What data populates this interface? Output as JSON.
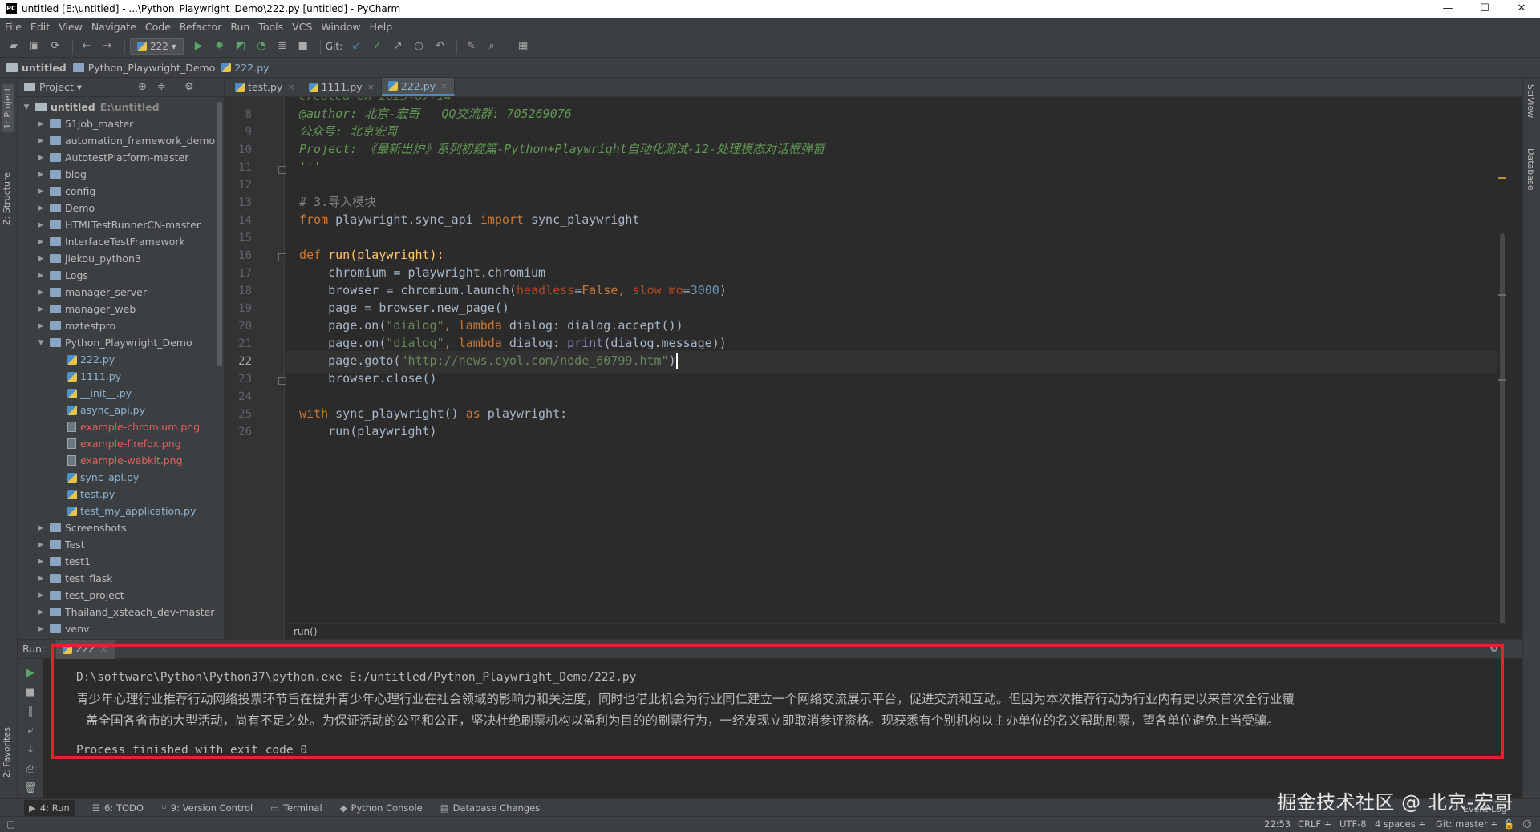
{
  "window": {
    "title": "untitled [E:\\untitled] - ...\\Python_Playwright_Demo\\222.py [untitled] - PyCharm",
    "app_icon": "PC",
    "controls": [
      "—",
      "☐",
      "✕"
    ]
  },
  "menu": [
    "File",
    "Edit",
    "View",
    "Navigate",
    "Code",
    "Refactor",
    "Run",
    "Tools",
    "VCS",
    "Window",
    "Help"
  ],
  "toolbar": {
    "run_config": "222 ▾",
    "git_label": "Git:"
  },
  "breadcrumb": [
    "untitled",
    "Python_Playwright_Demo",
    "222.py"
  ],
  "left_strip": {
    "tabs": [
      "1: Project",
      "Z: Structure",
      "2: Favorites"
    ]
  },
  "right_strip": {
    "tabs": [
      "SciView",
      "Database"
    ]
  },
  "project_panel": {
    "header": "Project ▾",
    "root": {
      "name": "untitled",
      "path": "E:\\untitled"
    },
    "folders_top": [
      "51job_master",
      "automation_framework_demo",
      "AutotestPlatform-master",
      "blog",
      "config",
      "Demo",
      "HTMLTestRunnerCN-master",
      "InterfaceTestFramework",
      "jiekou_python3",
      "Logs",
      "manager_server",
      "manager_web",
      "mztestpro"
    ],
    "open_folder": "Python_Playwright_Demo",
    "files": [
      {
        "name": "222.py",
        "kind": "py"
      },
      {
        "name": "1111.py",
        "kind": "py"
      },
      {
        "name": "__init__.py",
        "kind": "py"
      },
      {
        "name": "async_api.py",
        "kind": "py"
      },
      {
        "name": "example-chromium.png",
        "kind": "img"
      },
      {
        "name": "example-firefox.png",
        "kind": "img"
      },
      {
        "name": "example-webkit.png",
        "kind": "img"
      },
      {
        "name": "sync_api.py",
        "kind": "py"
      },
      {
        "name": "test.py",
        "kind": "py"
      },
      {
        "name": "test_my_application.py",
        "kind": "py"
      }
    ],
    "folders_bottom": [
      "Screenshots",
      "Test",
      "test1",
      "test_flask",
      "test_project",
      "Thailand_xsteach_dev-master",
      "venv"
    ]
  },
  "editor": {
    "tabs": [
      {
        "label": "test.py",
        "active": false
      },
      {
        "label": "1111.py",
        "active": false
      },
      {
        "label": "222.py",
        "active": true
      }
    ],
    "line_numbers": [
      "8",
      "9",
      "10",
      "11",
      "12",
      "13",
      "14",
      "15",
      "16",
      "17",
      "18",
      "19",
      "20",
      "21",
      "22",
      "23",
      "24",
      "25",
      "26"
    ],
    "current_line": "22",
    "partial_top": "created on 2023-07-14",
    "lines": {
      "l8": "@author: 北京-宏哥   QQ交流群: 705269076",
      "l9": "公众号: 北京宏哥",
      "l10": "Project: 《最新出炉》系列初窥篇-Python+Playwright自动化测试-12-处理模态对话框弹窗",
      "l11": "'''",
      "l13": "# 3.导入模块",
      "l14_kw1": "from",
      "l14_mod": " playwright.sync_api ",
      "l14_kw2": "import",
      "l14_name": " sync_playwright",
      "l16_kw": "def",
      "l16_rest": " run(playwright):",
      "l17": "    chromium = playwright.chromium",
      "l18_a": "    browser = chromium.launch(",
      "l18_p1": "headless",
      "l18_eq1": "=",
      "l18_v1": "False",
      "l18_c": ", ",
      "l18_p2": "slow_mo",
      "l18_eq2": "=",
      "l18_v2": "3000",
      "l18_e": ")",
      "l19": "    page = browser.new_page()",
      "l20_a": "    page.on(",
      "l20_s": "\"dialog\"",
      "l20_c": ", ",
      "l20_kw": "lambda",
      "l20_e": " dialog: dialog.accept())",
      "l21_a": "    page.on(",
      "l21_s": "\"dialog\"",
      "l21_c": ", ",
      "l21_kw": "lambda",
      "l21_m": " dialog: ",
      "l21_bi": "print",
      "l21_e": "(dialog.message))",
      "l22_a": "    page.goto(",
      "l22_s": "\"http://news.cyol.com/node_60799.htm\"",
      "l22_e": ")",
      "l23": "    browser.close()",
      "l25_kw1": "with",
      "l25_m": " sync_playwright() ",
      "l25_kw2": "as",
      "l25_e": " playwright:",
      "l26": "    run(playwright)"
    },
    "code_breadcrumb": "run()"
  },
  "run_panel": {
    "label": "Run:",
    "tab": "222",
    "command": "D:\\software\\Python\\Python37\\python.exe E:/untitled/Python_Playwright_Demo/222.py",
    "message_line1": "青少年心理行业推荐行动网络投票环节旨在提升青少年心理行业在社会领域的影响力和关注度，同时也借此机会为行业同仁建立一个网络交流展示平台，促进交流和互动。但因为本次推荐行动为行业内有史以来首次全行业覆",
    "message_line2": "盖全国各省市的大型活动，尚有不足之处。为保证活动的公平和公正，坚决杜绝刷票机构以盈利为目的的刷票行为，一经发现立即取消参评资格。现获悉有个别机构以主办单位的名义帮助刷票，望各单位避免上当受骗。",
    "exit": "Process finished with exit code 0"
  },
  "bottom_tools": [
    {
      "label": "4: Run",
      "icon": "▶"
    },
    {
      "label": "6: TODO",
      "icon": "☰"
    },
    {
      "label": "9: Version Control",
      "icon": "⑂"
    },
    {
      "label": "Terminal",
      "icon": "▭"
    },
    {
      "label": "Python Console",
      "icon": "◆"
    },
    {
      "label": "Database Changes",
      "icon": "▤"
    }
  ],
  "event_log": "Event Log",
  "status": {
    "position": "22:53",
    "line_sep": "CRLF ÷",
    "encoding": "UTF-8",
    "indent": "4 spaces ÷",
    "git": "Git: master ÷"
  },
  "watermark": "掘金技术社区 @ 北京-宏哥",
  "colors": {
    "highlight_box": "#e8212b",
    "keyword": "#cc7832",
    "string": "#6a8759",
    "comment": "#629755",
    "param": "#aa4926",
    "number": "#6897bb"
  }
}
